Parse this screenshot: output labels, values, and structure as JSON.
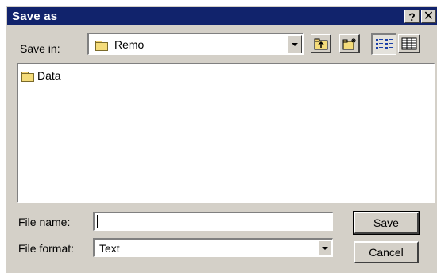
{
  "window": {
    "title": "Save as",
    "help_label": "?",
    "close_label": "✕"
  },
  "location": {
    "label": "Save in:",
    "current_folder": "Remo",
    "icons": [
      "folder-icon",
      "up-one-level-icon",
      "new-folder-icon",
      "list-view-icon",
      "details-view-icon"
    ]
  },
  "files": [
    {
      "name": "Data",
      "icon": "folder-icon"
    }
  ],
  "filename": {
    "label": "File name:",
    "value": ""
  },
  "fileformat": {
    "label": "File format:",
    "selected": "Text"
  },
  "buttons": {
    "save": "Save",
    "cancel": "Cancel"
  },
  "colors": {
    "titlebar": "#11236c",
    "face": "#d4d0c8"
  }
}
